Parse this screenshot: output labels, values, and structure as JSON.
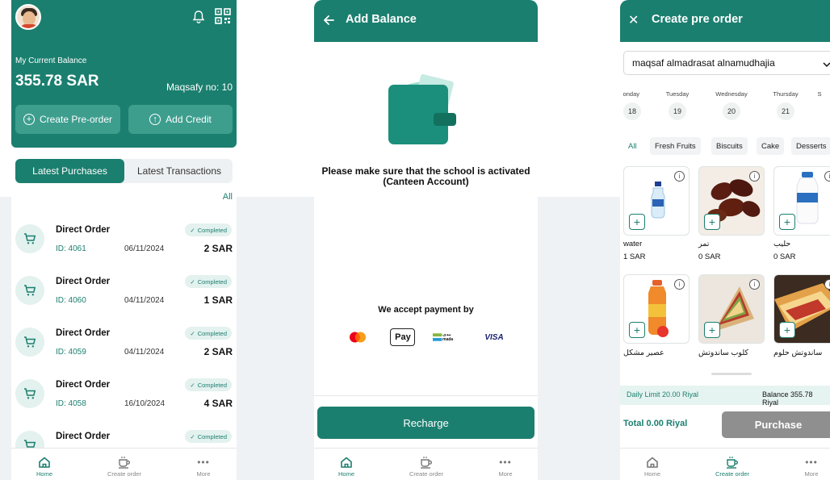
{
  "screen1": {
    "balance_label": "My Current Balance",
    "balance_value": "355.78 SAR",
    "maqsafy": "Maqsafy no: 10",
    "buttons": {
      "create_preorder": "Create Pre-order",
      "add_credit": "Add Credit"
    },
    "tabs": {
      "purchases": "Latest Purchases",
      "transactions": "Latest Transactions"
    },
    "all": "All",
    "orders": [
      {
        "title": "Direct Order",
        "id": "ID: 4061",
        "date": "06/11/2024",
        "status": "Completed",
        "amount": "2 SAR"
      },
      {
        "title": "Direct Order",
        "id": "ID: 4060",
        "date": "04/11/2024",
        "status": "Completed",
        "amount": "1 SAR"
      },
      {
        "title": "Direct Order",
        "id": "ID: 4059",
        "date": "04/11/2024",
        "status": "Completed",
        "amount": "2 SAR"
      },
      {
        "title": "Direct Order",
        "id": "ID: 4058",
        "date": "16/10/2024",
        "status": "Completed",
        "amount": "4 SAR"
      },
      {
        "title": "Direct Order",
        "id": "",
        "date": "",
        "status": "Completed",
        "amount": ""
      }
    ]
  },
  "screen2": {
    "title": "Add Balance",
    "note": "Please make sure that the school is activated (Canteen Account)",
    "accept": "We accept payment by",
    "apple_pay": "Pay",
    "mada": "مدى mada",
    "visa": "VISA",
    "recharge": "Recharge"
  },
  "screen3": {
    "title": "Create pre order",
    "school": "maqsaf almadrasat alnamudhajia",
    "days": [
      {
        "name": "onday",
        "num": "18"
      },
      {
        "name": "Tuesday",
        "num": "19"
      },
      {
        "name": "Wednesday",
        "num": "20"
      },
      {
        "name": "Thursday",
        "num": "21"
      },
      {
        "name": "S",
        "num": ""
      }
    ],
    "categories": [
      "All",
      "Fresh Fruits",
      "Biscuits",
      "Cake",
      "Desserts"
    ],
    "products": [
      {
        "name": "water",
        "price": "1 SAR",
        "icon": "water-bottle"
      },
      {
        "name": "تمر",
        "price": "0 SAR",
        "icon": "dates"
      },
      {
        "name": "حليب",
        "price": "0 SAR",
        "icon": "milk-bottle"
      },
      {
        "name": "عصير مشكل",
        "price": "",
        "icon": "juice-bottle"
      },
      {
        "name": "كلوب ساندوتش",
        "price": "",
        "icon": "club-sandwich"
      },
      {
        "name": "ساندوتش حلوم",
        "price": "",
        "icon": "halloumi-sandwich"
      }
    ],
    "daily_limit": "Daily Limit 20.00 Riyal",
    "balance": "Balance 355.78 Riyal",
    "total": "Total 0.00 Riyal",
    "purchase": "Purchase"
  },
  "nav": {
    "home": "Home",
    "create_order": "Create order",
    "more": "More"
  },
  "colors": {
    "accent": "#1b7f6f",
    "accent_light": "#e3f1ef",
    "disabled": "#8f8f8f"
  }
}
